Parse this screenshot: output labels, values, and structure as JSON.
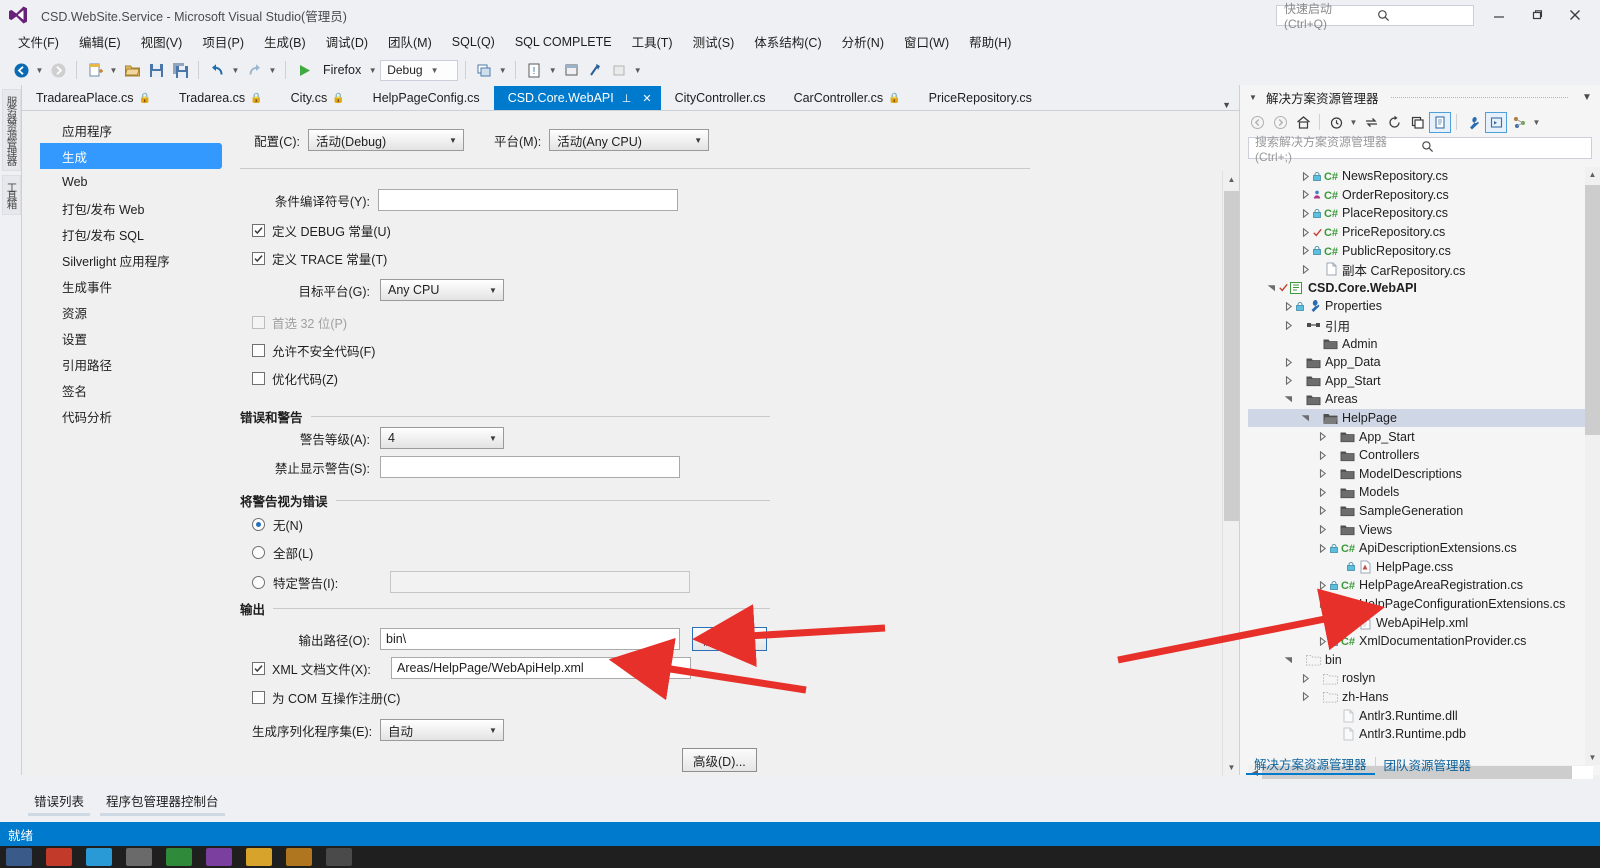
{
  "window": {
    "title": "CSD.WebSite.Service - Microsoft Visual Studio(管理员)",
    "logo_icon": "visual-studio-logo",
    "minimize_icon": "minimize-icon",
    "maximize_icon": "maximize-icon",
    "close_icon": "close-icon"
  },
  "quick_launch": {
    "placeholder": "快速启动 (Ctrl+Q)",
    "value": "",
    "icon": "search-icon"
  },
  "menu": {
    "items": [
      "文件(F)",
      "编辑(E)",
      "视图(V)",
      "项目(P)",
      "生成(B)",
      "调试(D)",
      "团队(M)",
      "SQL(Q)",
      "SQL COMPLETE",
      "工具(T)",
      "测试(S)",
      "体系结构(C)",
      "分析(N)",
      "窗口(W)",
      "帮助(H)"
    ]
  },
  "toolbar": {
    "navigate_back_icon": "navigate-back-icon",
    "navigate_forward_icon": "navigate-forward-icon",
    "new_project_icon": "new-project-icon",
    "open_file_icon": "open-file-icon",
    "save_icon": "save-icon",
    "save_all_icon": "save-all-icon",
    "undo_icon": "undo-icon",
    "redo_icon": "redo-icon",
    "start_icon": "start-debug-icon",
    "start_label": "Firefox",
    "config_value": "Debug",
    "solution_platform_icon": "solution-platforms-icon",
    "error_list_icon": "error-list-icon",
    "window_icon": "window-icon",
    "attach_icon": "attach-icon",
    "misc_icon": "misc-icon"
  },
  "vertical_dock": {
    "tabs": [
      "服务器资源管理器",
      "工具箱"
    ]
  },
  "document_tabs": {
    "items": [
      {
        "label": "TradareaPlace.cs",
        "locked": true,
        "active": false
      },
      {
        "label": "Tradarea.cs",
        "locked": true,
        "active": false
      },
      {
        "label": "City.cs",
        "locked": true,
        "active": false
      },
      {
        "label": "HelpPageConfig.cs",
        "locked": false,
        "active": false
      },
      {
        "label": "CSD.Core.WebAPI",
        "locked": false,
        "active": true
      },
      {
        "label": "CityController.cs",
        "locked": false,
        "active": false
      },
      {
        "label": "CarController.cs",
        "locked": true,
        "active": false
      },
      {
        "label": "PriceRepository.cs",
        "locked": false,
        "active": false
      }
    ],
    "pin_icon": "pin-icon",
    "close_icon": "close-icon",
    "overflow_icon": "chevron-down-icon"
  },
  "property_nav": {
    "items": [
      {
        "label": "应用程序",
        "selected": false
      },
      {
        "label": "生成",
        "selected": true
      },
      {
        "label": "Web",
        "selected": false
      },
      {
        "label": "打包/发布 Web",
        "selected": false
      },
      {
        "label": "打包/发布 SQL",
        "selected": false
      },
      {
        "label": "Silverlight 应用程序",
        "selected": false
      },
      {
        "label": "生成事件",
        "selected": false
      },
      {
        "label": "资源",
        "selected": false
      },
      {
        "label": "设置",
        "selected": false
      },
      {
        "label": "引用路径",
        "selected": false
      },
      {
        "label": "签名",
        "selected": false
      },
      {
        "label": "代码分析",
        "selected": false
      }
    ]
  },
  "build_page": {
    "configuration_label": "配置(C):",
    "configuration_value": "活动(Debug)",
    "platform_label": "平台(M):",
    "platform_value": "活动(Any CPU)",
    "conditional_symbols_label": "条件编译符号(Y):",
    "conditional_symbols_value": "",
    "define_debug_label": "定义 DEBUG 常量(U)",
    "define_debug_checked": true,
    "define_trace_label": "定义 TRACE 常量(T)",
    "define_trace_checked": true,
    "target_platform_label": "目标平台(G):",
    "target_platform_value": "Any CPU",
    "prefer32_label": "首选 32 位(P)",
    "prefer32_checked": false,
    "prefer32_disabled": true,
    "allow_unsafe_label": "允许不安全代码(F)",
    "allow_unsafe_checked": false,
    "optimize_label": "优化代码(Z)",
    "optimize_checked": false,
    "errors_group": "错误和警告",
    "warning_level_label": "警告等级(A):",
    "warning_level_value": "4",
    "suppress_warnings_label": "禁止显示警告(S):",
    "suppress_warnings_value": "",
    "treat_warnings_group": "将警告视为错误",
    "treat_none_label": "无(N)",
    "treat_all_label": "全部(L)",
    "treat_specific_label": "特定警告(I):",
    "treat_specific_value": "",
    "treat_selected": "none",
    "output_group": "输出",
    "output_path_label": "输出路径(O):",
    "output_path_value": "bin\\",
    "browse_button": "浏览(R)...",
    "xml_doc_label": "XML 文档文件(X):",
    "xml_doc_checked": true,
    "xml_doc_value": "Areas/HelpPage/WebApiHelp.xml",
    "register_com_label": "为 COM 互操作注册(C)",
    "register_com_checked": false,
    "serialization_label": "生成序列化程序集(E):",
    "serialization_value": "自动",
    "advanced_button": "高级(D)..."
  },
  "solution_explorer": {
    "title": "解决方案资源管理器",
    "collapse_icon": "chevron-down-icon",
    "menu_icon": "chevron-down-icon",
    "toolbar_icons": [
      "back-icon",
      "forward-icon",
      "home-icon",
      "pending-changes-icon",
      "sync-icon",
      "refresh-icon",
      "collapse-all-icon",
      "show-all-files-icon",
      "properties-icon",
      "preview-selected-items-icon",
      "class-view-icon",
      "overflow-icon"
    ],
    "search_placeholder": "搜索解决方案资源管理器(Ctrl+;)",
    "search_value": "",
    "tree": [
      {
        "label": "NewsRepository.cs",
        "indent": 3,
        "icon": "csharp-file-icon",
        "expander": "collapsed",
        "badge": "lock"
      },
      {
        "label": "OrderRepository.cs",
        "indent": 3,
        "icon": "csharp-file-icon",
        "expander": "collapsed",
        "badge": "user"
      },
      {
        "label": "PlaceRepository.cs",
        "indent": 3,
        "icon": "csharp-file-icon",
        "expander": "collapsed",
        "badge": "lock"
      },
      {
        "label": "PriceRepository.cs",
        "indent": 3,
        "icon": "csharp-file-icon",
        "expander": "collapsed",
        "badge": "check"
      },
      {
        "label": "PublicRepository.cs",
        "indent": 3,
        "icon": "csharp-file-icon",
        "expander": "collapsed",
        "badge": "lock"
      },
      {
        "label": "副本 CarRepository.cs",
        "indent": 3,
        "icon": "file-icon",
        "expander": "collapsed",
        "badge": ""
      },
      {
        "label": "CSD.Core.WebAPI",
        "indent": 1,
        "icon": "project-icon",
        "expander": "expanded",
        "badge": "check",
        "bold": true
      },
      {
        "label": "Properties",
        "indent": 2,
        "icon": "wrench-icon",
        "expander": "collapsed",
        "badge": "lock"
      },
      {
        "label": "引用",
        "indent": 2,
        "icon": "references-icon",
        "expander": "collapsed",
        "badge": ""
      },
      {
        "label": "Admin",
        "indent": 3,
        "icon": "folder-icon",
        "expander": "",
        "badge": ""
      },
      {
        "label": "App_Data",
        "indent": 2,
        "icon": "folder-icon",
        "expander": "collapsed",
        "badge": ""
      },
      {
        "label": "App_Start",
        "indent": 2,
        "icon": "folder-icon",
        "expander": "collapsed",
        "badge": ""
      },
      {
        "label": "Areas",
        "indent": 2,
        "icon": "folder-icon",
        "expander": "expanded",
        "badge": ""
      },
      {
        "label": "HelpPage",
        "indent": 3,
        "icon": "folder-open-icon",
        "expander": "expanded",
        "badge": "",
        "selected": true
      },
      {
        "label": "App_Start",
        "indent": 4,
        "icon": "folder-icon",
        "expander": "collapsed",
        "badge": ""
      },
      {
        "label": "Controllers",
        "indent": 4,
        "icon": "folder-icon",
        "expander": "collapsed",
        "badge": ""
      },
      {
        "label": "ModelDescriptions",
        "indent": 4,
        "icon": "folder-icon",
        "expander": "collapsed",
        "badge": ""
      },
      {
        "label": "Models",
        "indent": 4,
        "icon": "folder-icon",
        "expander": "collapsed",
        "badge": ""
      },
      {
        "label": "SampleGeneration",
        "indent": 4,
        "icon": "folder-icon",
        "expander": "collapsed",
        "badge": ""
      },
      {
        "label": "Views",
        "indent": 4,
        "icon": "folder-icon",
        "expander": "collapsed",
        "badge": ""
      },
      {
        "label": "ApiDescriptionExtensions.cs",
        "indent": 4,
        "icon": "csharp-file-icon",
        "expander": "collapsed",
        "badge": "lock"
      },
      {
        "label": "HelpPage.css",
        "indent": 5,
        "icon": "css-file-icon",
        "expander": "",
        "badge": "lock"
      },
      {
        "label": "HelpPageAreaRegistration.cs",
        "indent": 4,
        "icon": "csharp-file-icon",
        "expander": "collapsed",
        "badge": "lock"
      },
      {
        "label": "HelpPageConfigurationExtensions.cs",
        "indent": 4,
        "icon": "csharp-file-icon",
        "expander": "collapsed",
        "badge": "lock"
      },
      {
        "label": "WebApiHelp.xml",
        "indent": 5,
        "icon": "xml-file-icon",
        "expander": "",
        "badge": ""
      },
      {
        "label": "XmlDocumentationProvider.cs",
        "indent": 4,
        "icon": "csharp-file-icon",
        "expander": "collapsed",
        "badge": "lock"
      },
      {
        "label": "bin",
        "indent": 2,
        "icon": "folder-dim-icon",
        "expander": "expanded",
        "badge": ""
      },
      {
        "label": "roslyn",
        "indent": 3,
        "icon": "folder-dim-icon",
        "expander": "collapsed",
        "badge": ""
      },
      {
        "label": "zh-Hans",
        "indent": 3,
        "icon": "folder-dim-icon",
        "expander": "collapsed",
        "badge": ""
      },
      {
        "label": "Antlr3.Runtime.dll",
        "indent": 4,
        "icon": "file-dim-icon",
        "expander": "",
        "badge": ""
      },
      {
        "label": "Antlr3.Runtime.pdb",
        "indent": 4,
        "icon": "file-dim-icon",
        "expander": "",
        "badge": ""
      }
    ],
    "bottom_tabs": [
      {
        "label": "解决方案资源管理器",
        "active": true
      },
      {
        "label": "团队资源管理器",
        "active": false
      }
    ]
  },
  "bottom_tool_tabs": [
    {
      "label": "错误列表"
    },
    {
      "label": "程序包管理器控制台"
    }
  ],
  "status_bar": {
    "text": "就绪"
  },
  "colors": {
    "accent": "#007acc",
    "selection": "#3399ff",
    "tree_selection": "#cfd6e5",
    "annotation_arrow": "#e8302a",
    "chrome": "#eef0f3"
  },
  "annotations": [
    {
      "name": "arrow-to-browse-button",
      "color": "#e8302a"
    },
    {
      "name": "arrow-to-xml-doc-field",
      "color": "#e8302a"
    },
    {
      "name": "arrow-to-webapihelp-xml",
      "color": "#e8302a"
    }
  ]
}
